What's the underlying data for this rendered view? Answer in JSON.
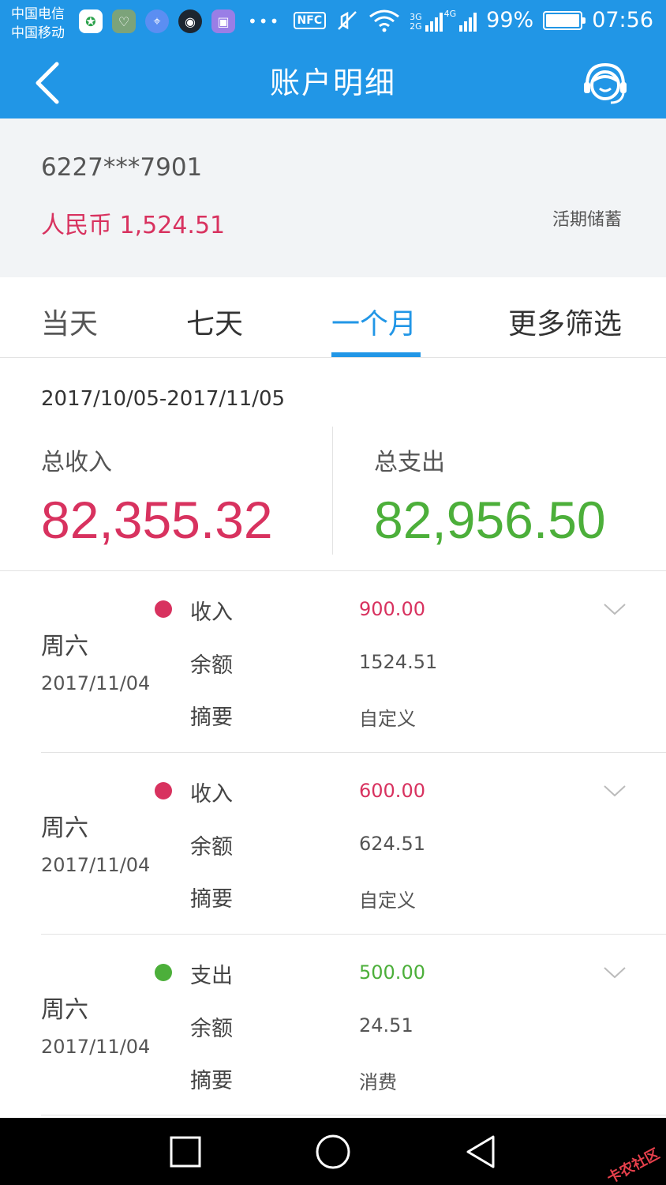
{
  "status_bar": {
    "carrier_1": "中国电信",
    "carrier_2": "中国移动",
    "nfc": "NFC",
    "net_1": "3G",
    "net_2": "2G",
    "net_3": "4G",
    "battery_percent": "99%",
    "battery_level": 0.99,
    "time": "07:56",
    "icons": [
      "app-icon",
      "health-app-icon",
      "location-app-icon",
      "dark-app-icon",
      "gallery-app-icon",
      "more-notifications-icon",
      "nfc-icon",
      "mute-icon",
      "wifi-icon",
      "signal-icon",
      "battery-icon"
    ]
  },
  "header": {
    "title": "账户明细",
    "back_icon": "chevron-left-icon",
    "service_icon": "customer-service-icon"
  },
  "account": {
    "number": "6227***7901",
    "balance": "人民币 1,524.51",
    "type": "活期储蓄"
  },
  "tabs": [
    {
      "label": "当天",
      "active": false
    },
    {
      "label": "七天",
      "active": false
    },
    {
      "label": "一个月",
      "active": true
    },
    {
      "label": "更多筛选",
      "active": false
    }
  ],
  "summary": {
    "range": "2017/10/05-2017/11/05",
    "income_label": "总收入",
    "income_value": "82,355.32",
    "expense_label": "总支出",
    "expense_value": "82,956.50"
  },
  "transactions": [
    {
      "weekday": "周六",
      "date": "2017/11/04",
      "type_label": "收入",
      "amount": "900.00",
      "balance_label": "余额",
      "balance": "1524.51",
      "memo_label": "摘要",
      "memo": "自定义",
      "color": "#d8325f"
    },
    {
      "weekday": "周六",
      "date": "2017/11/04",
      "type_label": "收入",
      "amount": "600.00",
      "balance_label": "余额",
      "balance": "624.51",
      "memo_label": "摘要",
      "memo": "自定义",
      "color": "#d8325f"
    },
    {
      "weekday": "周六",
      "date": "2017/11/04",
      "type_label": "支出",
      "amount": "500.00",
      "balance_label": "余额",
      "balance": "24.51",
      "memo_label": "摘要",
      "memo": "消费",
      "color": "#4caf3a"
    }
  ],
  "nav_bar": {
    "icons": [
      "recent-apps-icon",
      "home-icon",
      "back-triangle-icon"
    ]
  },
  "watermark": "卡农社区",
  "colors": {
    "primary": "#2196e6",
    "income": "#d8325f",
    "expense": "#4caf3a"
  }
}
